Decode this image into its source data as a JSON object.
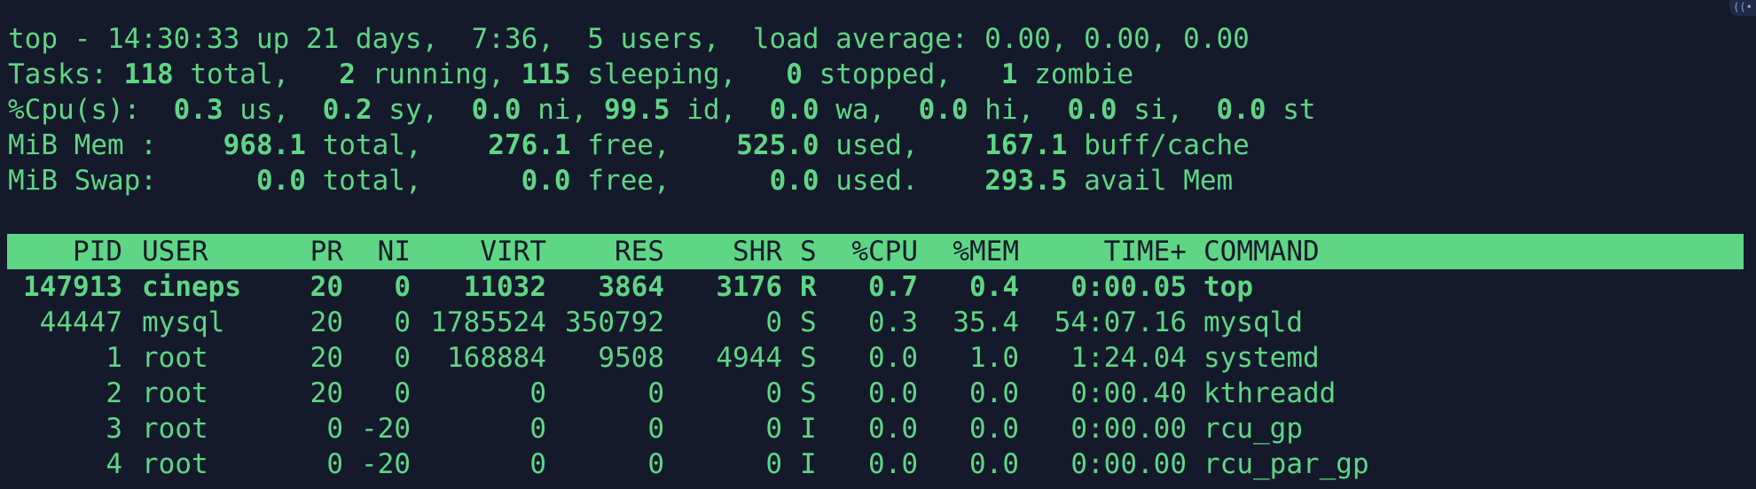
{
  "summary": {
    "line1": "top - 14:30:33 up 21 days,  7:36,  5 users,  load average: 0.00, 0.00, 0.00",
    "tasks": {
      "prefix": "Tasks: ",
      "total": "118",
      "total_label": " total,   ",
      "running": "2",
      "running_label": " running, ",
      "sleeping": "115",
      "sleeping_label": " sleeping,   ",
      "stopped": "0",
      "stopped_label": " stopped,   ",
      "zombie": "1",
      "zombie_label": " zombie"
    },
    "cpu": {
      "prefix": "%Cpu(s):  ",
      "us": "0.3",
      "us_label": " us,  ",
      "sy": "0.2",
      "sy_label": " sy,  ",
      "ni": "0.0",
      "ni_label": " ni, ",
      "id": "99.5",
      "id_label": " id,  ",
      "wa": "0.0",
      "wa_label": " wa,  ",
      "hi": "0.0",
      "hi_label": " hi,  ",
      "si": "0.0",
      "si_label": " si,  ",
      "st": "0.0",
      "st_label": " st"
    },
    "mem": {
      "prefix": "MiB Mem :    ",
      "total": "968.1",
      "total_label": " total,    ",
      "free": "276.1",
      "free_label": " free,    ",
      "used": "525.0",
      "used_label": " used,    ",
      "buff": "167.1",
      "buff_label": " buff/cache"
    },
    "swap": {
      "prefix": "MiB Swap:      ",
      "total": "0.0",
      "total_label": " total,      ",
      "free": "0.0",
      "free_label": " free,      ",
      "used": "0.0",
      "used_label": " used.    ",
      "avail": "293.5",
      "avail_label": " avail Mem"
    }
  },
  "columns": {
    "pid": "PID",
    "user": "USER",
    "pr": "PR",
    "ni": "NI",
    "virt": "VIRT",
    "res": "RES",
    "shr": "SHR",
    "s": "S",
    "cpu": "%CPU",
    "mem": "%MEM",
    "time": "TIME+",
    "command": "COMMAND"
  },
  "processes": [
    {
      "pid": "147913",
      "user": "cineps",
      "pr": "20",
      "ni": "0",
      "virt": "11032",
      "res": "3864",
      "shr": "3176",
      "s": "R",
      "cpu": "0.7",
      "mem": "0.4",
      "time": "0:00.05",
      "command": "top"
    },
    {
      "pid": "44447",
      "user": "mysql",
      "pr": "20",
      "ni": "0",
      "virt": "1785524",
      "res": "350792",
      "shr": "0",
      "s": "S",
      "cpu": "0.3",
      "mem": "35.4",
      "time": "54:07.16",
      "command": "mysqld"
    },
    {
      "pid": "1",
      "user": "root",
      "pr": "20",
      "ni": "0",
      "virt": "168884",
      "res": "9508",
      "shr": "4944",
      "s": "S",
      "cpu": "0.0",
      "mem": "1.0",
      "time": "1:24.04",
      "command": "systemd"
    },
    {
      "pid": "2",
      "user": "root",
      "pr": "20",
      "ni": "0",
      "virt": "0",
      "res": "0",
      "shr": "0",
      "s": "S",
      "cpu": "0.0",
      "mem": "0.0",
      "time": "0:00.40",
      "command": "kthreadd"
    },
    {
      "pid": "3",
      "user": "root",
      "pr": "0",
      "ni": "-20",
      "virt": "0",
      "res": "0",
      "shr": "0",
      "s": "I",
      "cpu": "0.0",
      "mem": "0.0",
      "time": "0:00.00",
      "command": "rcu_gp"
    },
    {
      "pid": "4",
      "user": "root",
      "pr": "0",
      "ni": "-20",
      "virt": "0",
      "res": "0",
      "shr": "0",
      "s": "I",
      "cpu": "0.0",
      "mem": "0.0",
      "time": "0:00.00",
      "command": "rcu_par_gp"
    }
  ],
  "icons": {
    "corner": "broadcast-icon"
  }
}
